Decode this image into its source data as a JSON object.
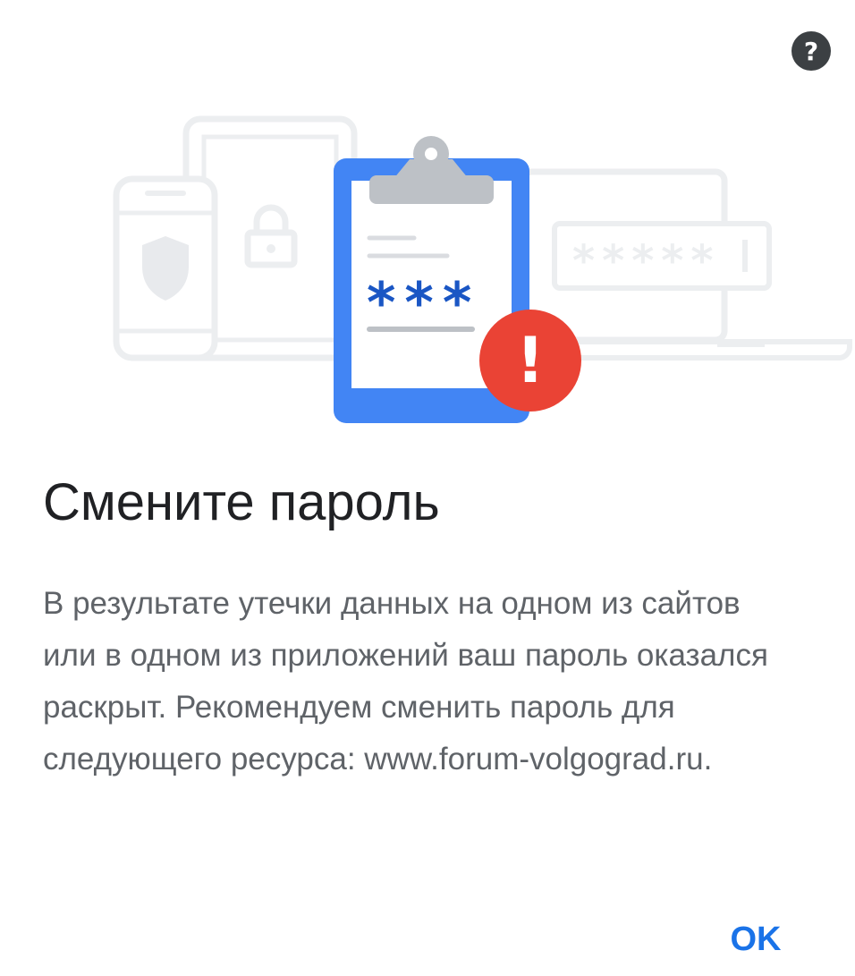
{
  "dialog": {
    "help_icon_glyph": "?",
    "title": "Смените пароль",
    "body": "В результате утечки данных на одном из сайтов или в одном из приложений ваш пароль оказался раскрыт. Рекомендуем сменить пароль для следующего ресурса: www.forum-volgograd.ru.",
    "ok_label": "OK"
  },
  "illustration": {
    "clipboard_password": "***",
    "laptop_password_field": "*****",
    "alert_mark": "!"
  },
  "colors": {
    "accent": "#1a73e8",
    "clipboard_blue": "#4285f4",
    "alert_red": "#ea4335",
    "title": "#202124",
    "body": "#5f6368",
    "help_bg": "#3c4043",
    "faded_outline": "#eceef0"
  },
  "icons": [
    "help-icon",
    "phone-icon",
    "shield-icon",
    "tablet-icon",
    "lock-icon",
    "clipboard-icon",
    "laptop-icon",
    "password-field-icon",
    "alert-icon"
  ]
}
